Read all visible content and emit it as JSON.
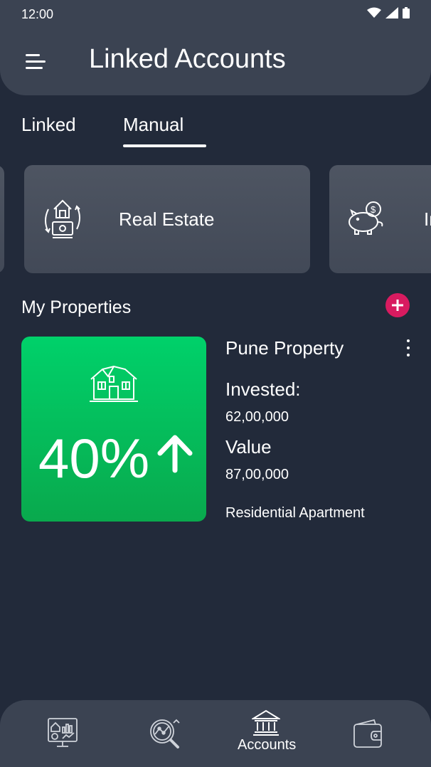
{
  "status_bar": {
    "time": "12:00"
  },
  "header": {
    "title": "Linked Accounts"
  },
  "tabs": [
    {
      "label": "Linked",
      "active": false
    },
    {
      "label": "Manual",
      "active": true
    }
  ],
  "categories": [
    {
      "label": "Real Estate",
      "icon": "house-exchange-icon"
    },
    {
      "label": "In",
      "icon": "piggy-bank-icon"
    }
  ],
  "properties_section": {
    "title": "My Properties"
  },
  "property": {
    "name": "Pune Property",
    "change": "40%",
    "trend": "up",
    "invested_label": "Invested:",
    "invested_value": "62,00,000",
    "value_label": "Value",
    "value_amount": "87,00,000",
    "type": "Residential Apartment"
  },
  "bottom_nav": [
    {
      "icon": "dashboard-icon",
      "label": ""
    },
    {
      "icon": "analytics-search-icon",
      "label": ""
    },
    {
      "icon": "bank-icon",
      "label": "Accounts",
      "active": true
    },
    {
      "icon": "wallet-icon",
      "label": ""
    }
  ],
  "colors": {
    "background": "#222a3a",
    "header": "#3b4352",
    "card": "#4a5160",
    "tile_green": "#00c85f",
    "accent_pink": "#d81b60"
  }
}
